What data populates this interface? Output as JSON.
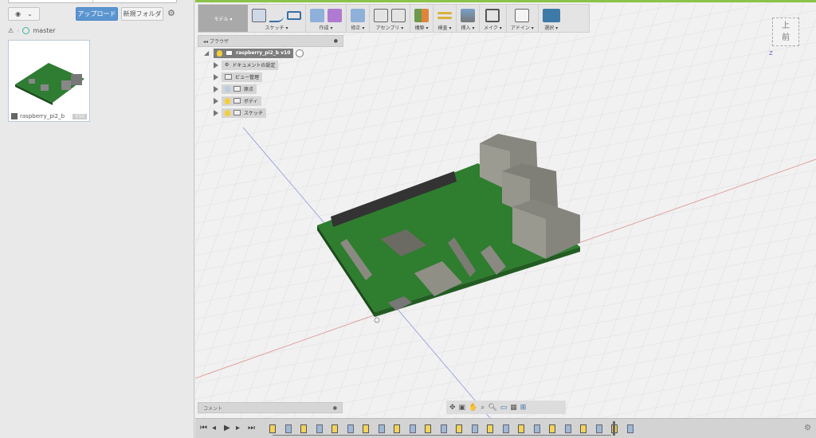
{
  "data_panel": {
    "upload_label": "アップロード",
    "new_folder_label": "新規フォルダ",
    "branch": "master",
    "file": {
      "name": "raspberry_pi2_b",
      "version": "V10"
    }
  },
  "toolbar": {
    "workspace": "モデル ▾",
    "groups": [
      "スケッチ ▾",
      "作成 ▾",
      "修正 ▾",
      "アセンブリ ▾",
      "構築 ▾",
      "検査 ▾",
      "挿入 ▾",
      "メイク ▾",
      "アドイン ▾",
      "選択 ▾"
    ]
  },
  "browser": {
    "title": "ブラウザ",
    "root": "raspberry_pi2_b v10",
    "items": [
      {
        "label": "ドキュメントの設定"
      },
      {
        "label": "ビュー管理"
      },
      {
        "label": "原点"
      },
      {
        "label": "ボディ"
      },
      {
        "label": "スケッチ"
      }
    ]
  },
  "viewcube": {
    "top": "上",
    "front": "前",
    "axis": "Z"
  },
  "comment": {
    "label": "コメント"
  },
  "timeline": {
    "steps": 24
  }
}
